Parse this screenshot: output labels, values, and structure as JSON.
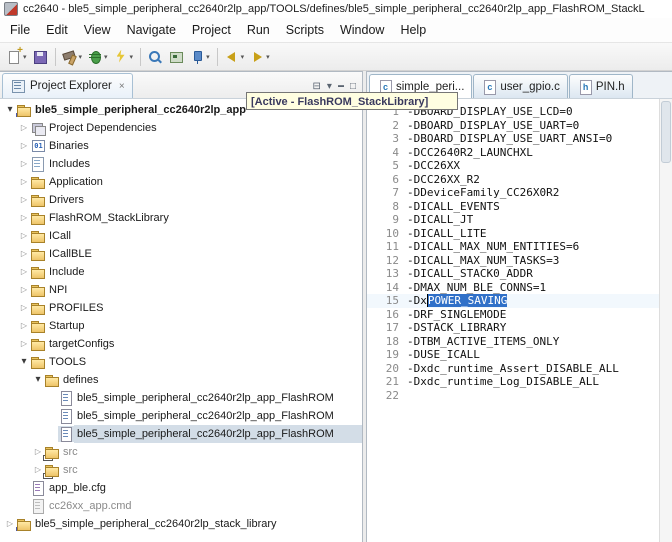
{
  "window": {
    "title": "cc2640 - ble5_simple_peripheral_cc2640r2lp_app/TOOLS/defines/ble5_simple_peripheral_cc2640r2lp_app_FlashROM_StackL"
  },
  "menu": {
    "items": [
      "File",
      "Edit",
      "View",
      "Navigate",
      "Project",
      "Run",
      "Scripts",
      "Window",
      "Help"
    ]
  },
  "toolbar": {
    "items": [
      {
        "name": "new-file",
        "dd": true
      },
      {
        "name": "save"
      },
      {
        "sep": true
      },
      {
        "name": "build",
        "dd": true
      },
      {
        "name": "debug",
        "dd": true
      },
      {
        "name": "flash",
        "dd": true
      },
      {
        "sep": true
      },
      {
        "name": "search"
      },
      {
        "name": "new-target-config"
      },
      {
        "name": "pin",
        "dd": true
      },
      {
        "sep": true
      },
      {
        "name": "back",
        "dd": true
      },
      {
        "name": "forward",
        "dd": true
      }
    ]
  },
  "explorer": {
    "tab_label": "Project Explorer",
    "active_decoration": "[Active - FlashROM_StackLibrary]",
    "tree": [
      {
        "level": 0,
        "arrow": "expanded",
        "icon": "project",
        "label": "ble5_simple_peripheral_cc2640r2lp_app",
        "bold": true
      },
      {
        "level": 1,
        "arrow": "collapsed",
        "icon": "deps",
        "label": "Project Dependencies"
      },
      {
        "level": 1,
        "arrow": "collapsed",
        "icon": "binaries",
        "label": "Binaries"
      },
      {
        "level": 1,
        "arrow": "collapsed",
        "icon": "includes",
        "label": "Includes"
      },
      {
        "level": 1,
        "arrow": "collapsed",
        "icon": "folder",
        "label": "Application"
      },
      {
        "level": 1,
        "arrow": "collapsed",
        "icon": "folder",
        "label": "Drivers"
      },
      {
        "level": 1,
        "arrow": "collapsed",
        "icon": "folder",
        "label": "FlashROM_StackLibrary"
      },
      {
        "level": 1,
        "arrow": "collapsed",
        "icon": "folder",
        "label": "ICall"
      },
      {
        "level": 1,
        "arrow": "collapsed",
        "icon": "folder",
        "label": "ICallBLE"
      },
      {
        "level": 1,
        "arrow": "collapsed",
        "icon": "folder",
        "label": "Include"
      },
      {
        "level": 1,
        "arrow": "collapsed",
        "icon": "folder",
        "label": "NPI"
      },
      {
        "level": 1,
        "arrow": "collapsed",
        "icon": "folder",
        "label": "PROFILES"
      },
      {
        "level": 1,
        "arrow": "collapsed",
        "icon": "folder",
        "label": "Startup"
      },
      {
        "level": 1,
        "arrow": "collapsed",
        "icon": "folder",
        "label": "targetConfigs"
      },
      {
        "level": 1,
        "arrow": "expanded",
        "icon": "folder",
        "label": "TOOLS"
      },
      {
        "level": 2,
        "arrow": "expanded",
        "icon": "folder",
        "label": "defines"
      },
      {
        "level": 3,
        "arrow": "none",
        "icon": "textfile",
        "label": "ble5_simple_peripheral_cc2640r2lp_app_FlashROM"
      },
      {
        "level": 3,
        "arrow": "none",
        "icon": "textfile",
        "label": "ble5_simple_peripheral_cc2640r2lp_app_FlashROM"
      },
      {
        "level": 3,
        "arrow": "none",
        "icon": "textfile",
        "label": "ble5_simple_peripheral_cc2640r2lp_app_FlashROM",
        "selected": true
      },
      {
        "level": 2,
        "arrow": "collapsed",
        "icon": "folder-link",
        "label": "src",
        "dim": true
      },
      {
        "level": 2,
        "arrow": "collapsed",
        "icon": "folder-link",
        "label": "src",
        "dim": true
      },
      {
        "level": 1,
        "arrow": "none",
        "icon": "cfgfile",
        "label": "app_ble.cfg"
      },
      {
        "level": 1,
        "arrow": "none",
        "icon": "cmdfile",
        "label": "cc26xx_app.cmd",
        "dim": true
      },
      {
        "level": 0,
        "arrow": "collapsed",
        "icon": "project",
        "label": "ble5_simple_peripheral_cc2640r2lp_stack_library"
      }
    ]
  },
  "editor": {
    "tabs": [
      {
        "label": "simple_peri...",
        "icon": "c-file",
        "selected": true
      },
      {
        "label": "user_gpio.c",
        "icon": "c-file"
      },
      {
        "label": "PIN.h",
        "icon": "h-file"
      }
    ],
    "lines": [
      {
        "n": 1,
        "text": "-DBOARD_DISPLAY_USE_LCD=0"
      },
      {
        "n": 2,
        "text": "-DBOARD_DISPLAY_USE_UART=0"
      },
      {
        "n": 3,
        "text": "-DBOARD_DISPLAY_USE_UART_ANSI=0"
      },
      {
        "n": 4,
        "text": "-DCC2640R2_LAUNCHXL"
      },
      {
        "n": 5,
        "text": "-DCC26XX"
      },
      {
        "n": 6,
        "text": "-DCC26XX_R2"
      },
      {
        "n": 7,
        "text": "-DDeviceFamily_CC26X0R2"
      },
      {
        "n": 8,
        "text": "-DICALL_EVENTS"
      },
      {
        "n": 9,
        "text": "-DICALL_JT"
      },
      {
        "n": 10,
        "text": "-DICALL_LITE"
      },
      {
        "n": 11,
        "text": "-DICALL_MAX_NUM_ENTITIES=6"
      },
      {
        "n": 12,
        "text": "-DICALL_MAX_NUM_TASKS=3"
      },
      {
        "n": 13,
        "text": "-DICALL_STACK0_ADDR"
      },
      {
        "n": 14,
        "text": "-DMAX_NUM_BLE_CONNS=1"
      },
      {
        "n": 15,
        "pre": "-Dx",
        "sel": "POWER_SAVING",
        "current": true
      },
      {
        "n": 16,
        "text": "-DRF_SINGLEMODE"
      },
      {
        "n": 17,
        "text": "-DSTACK_LIBRARY"
      },
      {
        "n": 18,
        "text": "-DTBM_ACTIVE_ITEMS_ONLY"
      },
      {
        "n": 19,
        "text": "-DUSE_ICALL"
      },
      {
        "n": 20,
        "text": "-Dxdc_runtime_Assert_DISABLE_ALL"
      },
      {
        "n": 21,
        "text": "-Dxdc_runtime_Log_DISABLE_ALL"
      },
      {
        "n": 22,
        "text": ""
      }
    ]
  }
}
